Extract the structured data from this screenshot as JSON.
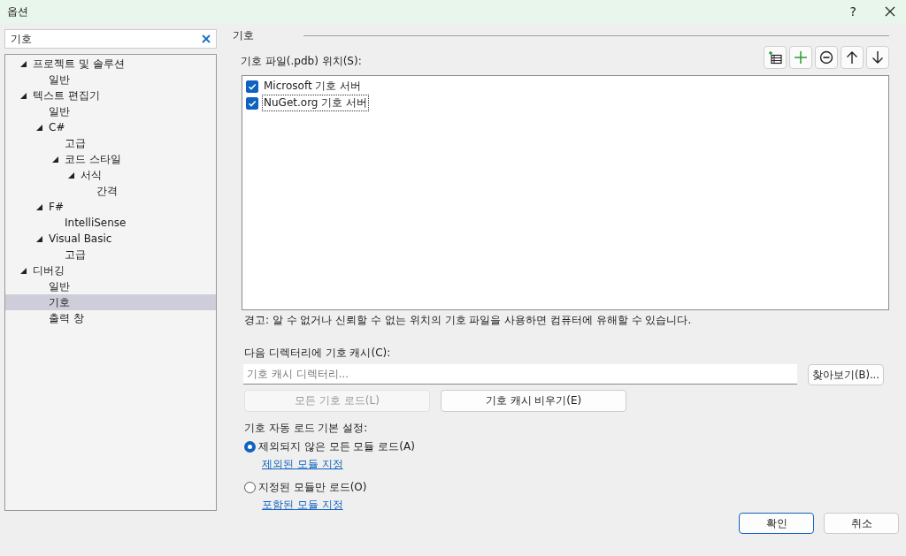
{
  "window": {
    "title": "옵션",
    "help": "?"
  },
  "search": {
    "value": "기호"
  },
  "tree": [
    {
      "label": "프로젝트 및 솔루션",
      "expanded": true,
      "selected": false,
      "children": [
        {
          "label": "일반",
          "selected": false
        }
      ]
    },
    {
      "label": "텍스트 편집기",
      "expanded": true,
      "selected": false,
      "children": [
        {
          "label": "일반",
          "selected": false
        },
        {
          "label": "C#",
          "expanded": true,
          "selected": false,
          "children": [
            {
              "label": "고급",
              "selected": false
            },
            {
              "label": "코드 스타일",
              "expanded": true,
              "selected": false,
              "children": [
                {
                  "label": "서식",
                  "expanded": true,
                  "selected": false,
                  "children": [
                    {
                      "label": "간격",
                      "selected": false
                    }
                  ]
                }
              ]
            }
          ]
        },
        {
          "label": "F#",
          "expanded": true,
          "selected": false,
          "children": [
            {
              "label": "IntelliSense",
              "selected": false
            }
          ]
        },
        {
          "label": "Visual Basic",
          "expanded": true,
          "selected": false,
          "children": [
            {
              "label": "고급",
              "selected": false
            }
          ]
        }
      ]
    },
    {
      "label": "디버깅",
      "expanded": true,
      "selected": false,
      "children": [
        {
          "label": "일반",
          "selected": false
        },
        {
          "label": "기호",
          "selected": true
        },
        {
          "label": "출력 창",
          "selected": false
        }
      ]
    }
  ],
  "section_title": "기호",
  "locations_label": "기호 파일(.pdb) 위치(S):",
  "toolbar": [
    {
      "kind": "add-list"
    },
    {
      "kind": "add"
    },
    {
      "kind": "remove"
    },
    {
      "kind": "up"
    },
    {
      "kind": "down"
    }
  ],
  "locations": [
    {
      "label": "Microsoft 기호 서버",
      "checked": true,
      "focused": false
    },
    {
      "label": "NuGet.org 기호 서버",
      "checked": true,
      "focused": true
    }
  ],
  "warning": "경고: 알 수 없거나 신뢰할 수 없는 위치의 기호 파일을 사용하면 컴퓨터에 유해할 수 있습니다.",
  "cache_label": "다음 디렉터리에 기호 캐시(C):",
  "cache_field": {
    "placeholder": "기호 캐시 디렉터리..."
  },
  "browse_button": "찾아보기(B)...",
  "load_all_button": {
    "label": "모든 기호 로드(L)",
    "disabled": true
  },
  "clear_cache_button": {
    "label": "기호 캐시 비우기(E)",
    "disabled": false
  },
  "autoload_label": "기호 자동 로드 기본 설정:",
  "autoload_options": [
    {
      "label": "제외되지 않은 모든 모듈 로드(A)",
      "selected": true,
      "link": "제외된 모듈 지정"
    },
    {
      "label": "지정된 모듈만 로드(O)",
      "selected": false,
      "link": "포함된 모듈 지정"
    }
  ],
  "ok_button": "확인",
  "cancel_button": "취소"
}
